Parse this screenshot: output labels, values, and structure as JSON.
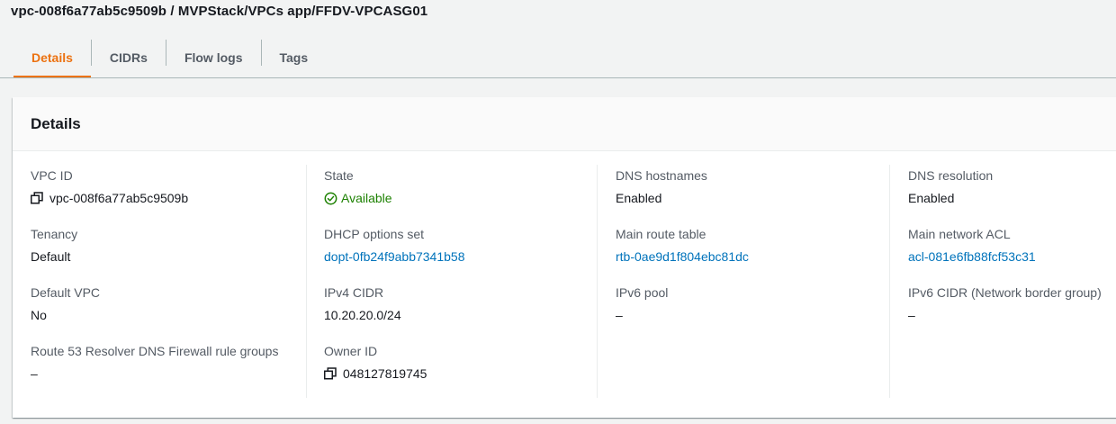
{
  "page": {
    "title": "vpc-008f6a77ab5c9509b / MVPStack/VPCs app/FFDV-VPCASG01"
  },
  "tabs": [
    {
      "label": "Details",
      "active": true
    },
    {
      "label": "CIDRs",
      "active": false
    },
    {
      "label": "Flow logs",
      "active": false
    },
    {
      "label": "Tags",
      "active": false
    }
  ],
  "panel": {
    "header": "Details"
  },
  "fields": {
    "vpc_id": {
      "label": "VPC ID",
      "value": "vpc-008f6a77ab5c9509b",
      "icon": "copy-icon"
    },
    "tenancy": {
      "label": "Tenancy",
      "value": "Default"
    },
    "default_vpc": {
      "label": "Default VPC",
      "value": "No"
    },
    "route53": {
      "label": "Route 53 Resolver DNS Firewall rule groups",
      "value": "–"
    },
    "state": {
      "label": "State",
      "value": "Available",
      "icon": "check-circle-icon",
      "color": "#1d8102"
    },
    "dhcp": {
      "label": "DHCP options set",
      "value": "dopt-0fb24f9abb7341b58"
    },
    "ipv4": {
      "label": "IPv4 CIDR",
      "value": "10.20.20.0/24"
    },
    "owner": {
      "label": "Owner ID",
      "value": "048127819745",
      "icon": "copy-icon"
    },
    "dns_hostnames": {
      "label": "DNS hostnames",
      "value": "Enabled"
    },
    "main_route": {
      "label": "Main route table",
      "value": "rtb-0ae9d1f804ebc81dc"
    },
    "ipv6_pool": {
      "label": "IPv6 pool",
      "value": "–"
    },
    "dns_resolution": {
      "label": "DNS resolution",
      "value": "Enabled"
    },
    "main_acl": {
      "label": "Main network ACL",
      "value": "acl-081e6fb88fcf53c31"
    },
    "ipv6_cidr": {
      "label": "IPv6 CIDR (Network border group)",
      "value": "–"
    }
  },
  "colors": {
    "accent": "#ec7211",
    "link": "#0073bb",
    "success": "#1d8102"
  }
}
